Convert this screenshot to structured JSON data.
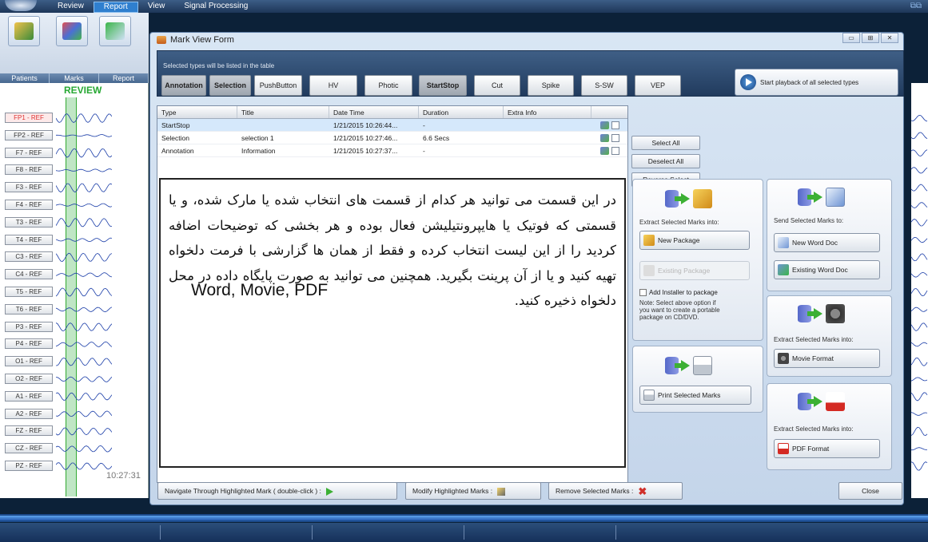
{
  "menu": {
    "tabs": [
      "Review",
      "Report",
      "View",
      "Signal Processing"
    ]
  },
  "ribbon": {
    "buttons": [
      "Patients",
      "Marks",
      "Report"
    ]
  },
  "eeg": {
    "review_label": "REVIEW",
    "channels": [
      "FP1 - REF",
      "FP2 - REF",
      "F7 - REF",
      "F8 - REF",
      "F3 - REF",
      "F4 - REF",
      "T3 - REF",
      "T4 - REF",
      "C3 - REF",
      "C4 - REF",
      "T5 - REF",
      "T6 - REF",
      "P3 - REF",
      "P4 - REF",
      "O1 - REF",
      "O2 - REF",
      "A1 - REF",
      "A2 - REF",
      "FZ - REF",
      "CZ - REF",
      "PZ - REF"
    ],
    "time": "10:27:31"
  },
  "dialog": {
    "title": "Mark View Form",
    "hint": "Selected types will be listed in the table",
    "type_buttons": [
      "Annotation",
      "Selection",
      "PushButton",
      "HV",
      "Photic",
      "StartStop",
      "Cut",
      "Spike",
      "S-SW",
      "VEP"
    ],
    "play_label": "Start playback of all selected types",
    "columns": [
      "Type",
      "Title",
      "Date Time",
      "Duration",
      "Extra Info"
    ],
    "rows": [
      {
        "type": "StartStop",
        "title": "",
        "datetime": "1/21/2015 10:26:44...",
        "duration": "-",
        "extra": ""
      },
      {
        "type": "Selection",
        "title": "selection 1",
        "datetime": "1/21/2015 10:27:46...",
        "duration": "6.6 Secs",
        "extra": ""
      },
      {
        "type": "Annotation",
        "title": "Information",
        "datetime": "1/21/2015 10:27:37...",
        "duration": "-",
        "extra": ""
      }
    ],
    "select_all": "Select All",
    "deselect_all": "Deselect All",
    "reverse_select": "Reverse Select",
    "package_panel": {
      "label": "Extract Selected Marks into:",
      "new_package": "New Package",
      "existing_package": "Existing Package",
      "add_installer": "Add Installer to package",
      "note": "Note: Select above option if you want to create a portable package on CD/DVD."
    },
    "word_panel": {
      "label": "Send Selected Marks to:",
      "new_word": "New Word Doc",
      "existing_word": "Existing Word Doc"
    },
    "movie_panel": {
      "label": "Extract Selected Marks into:",
      "movie_format": "Movie Format"
    },
    "print_panel": {
      "print": "Print Selected Marks"
    },
    "pdf_panel": {
      "label": "Extract Selected Marks into:",
      "pdf_format": "PDF Format"
    },
    "bottom": {
      "navigate": "Navigate Through Highlighted Mark ( double-click ) :",
      "modify": "Modify Highlighted Marks :",
      "remove": "Remove Selected Marks :",
      "close": "Close"
    }
  },
  "note": {
    "persian": "در این قسمت می توانید هر کدام از قسمت های انتخاب شده یا مارک شده، و یا قسمتی که فوتیک یا هایپرونتیلیشن فعال بوده و هر بخشی که توضیحات اضافه کردید را از این لیست انتخاب کرده و فقط از همان ها گزارشی با فرمت دلخواه تهیه کنید و یا از آن پرینت بگیرید. همچنین می توانید به صورت پایگاه داده در محل دلخواه ذخیره کنید.",
    "english": "Word, Movie, PDF"
  },
  "colors": {
    "accent": "#2f7fcf",
    "review_green": "#27a833",
    "status_bar": "#15305a"
  }
}
